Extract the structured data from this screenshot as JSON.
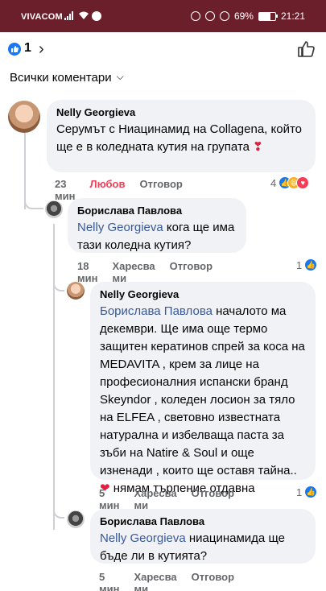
{
  "status_bar": {
    "carrier": "VIVACOM",
    "battery": "69%",
    "battery_level": 0.69,
    "time": "21:21"
  },
  "header": {
    "like_count": "1",
    "filter_label": "Всички коментари"
  },
  "comments": [
    {
      "author": "Nelly Georgieva",
      "text": "Серумът с Ниацинамид на Collagena, който ще е в коледната кутия на групата",
      "time": "23 мин",
      "reaction_label": "Любов",
      "reply_label": "Отговор",
      "reaction_count": "4"
    },
    {
      "author": "Борислава Павлова",
      "mention": "Nelly Georgieva",
      "text": " кога ще има тази коледна кутия?",
      "time": "18 мин",
      "like_label": "Харесва ми",
      "reply_label": "Отговор",
      "reaction_count": "1"
    },
    {
      "author": "Nelly Georgieva",
      "mention": "Борислава Павлова",
      "text": " началото ма декември. Ще има още термо защитен кератинов спрей за коса на MEDAVITA , крем за лице на професионалния испански бранд Skeyndor , коледен лосион за тяло на ELFEA , световно известната натурална и избелваща паста за зъби на Natire & Soul и още изненади , които ще оставя тайна..",
      "text_after_heart": " нямам търпение отдавна",
      "time": "5 мин",
      "like_label": "Харесва ми",
      "reply_label": "Отговор",
      "reaction_count": "1"
    },
    {
      "author": "Борислава Павлова",
      "mention": "Nelly Georgieva",
      "text": " ниацинамида ще бъде ли в кутията?",
      "time": "5 мин",
      "like_label": "Харесва ми",
      "reply_label": "Отговор"
    }
  ],
  "colors": {
    "status_bar": "#6b1f2a",
    "bubble": "#f0f2f5",
    "mention": "#385898",
    "love": "#f33e58",
    "like": "#1877f2"
  }
}
